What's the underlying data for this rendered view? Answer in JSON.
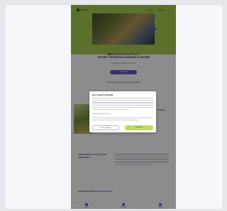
{
  "site": {
    "logo": "Moodle",
    "nav": [
      "Menu",
      "Contact"
    ],
    "hero_heading_pre": "MEET",
    "hero_heading_highlight": "MOODLEWORKPLACE",
    "hero_heading_post": "THE NEXT GENERATION LEARNING PLATFORM",
    "hero_subtext": "Learning that works for everyone",
    "cta_label": "Get started",
    "section2_heading": "Powerful learning solutions for businesses",
    "side_text": "Learning",
    "section3_heading_pre": "Personalised",
    "section3_heading_highlight": "learning",
    "section3_heading_post": "for your organisation",
    "section4_heading_pre": "Learn more about",
    "section4_heading_highlight": "Moodle Workplace",
    "features": [
      "Engage",
      "Manage",
      "Report"
    ]
  },
  "cookie_dialog": {
    "title": "Our Cookies and Data",
    "link_text": "Privacy Policy & Cookies",
    "settings_label": "Cookie Settings",
    "accept_label": "Accept All"
  },
  "colors": {
    "header_green": "#a6cc4e",
    "accent_purple": "#6a55c8",
    "accept_green": "#b8df5c"
  }
}
